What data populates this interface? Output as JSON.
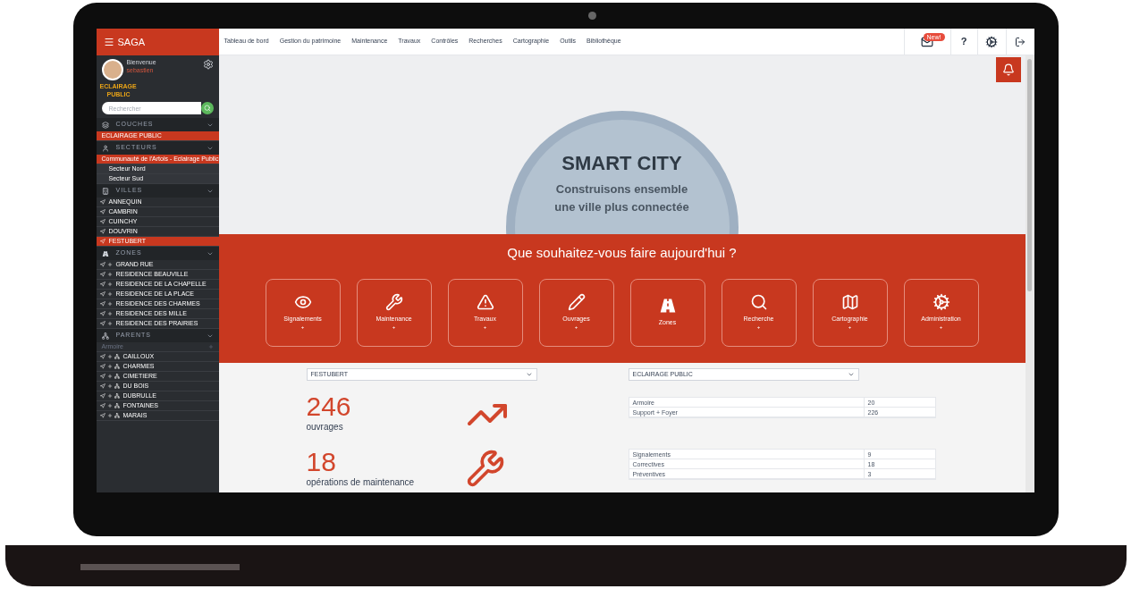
{
  "sidebar": {
    "brand": "SAGA",
    "greeting": "Bienvenue",
    "user_name": "sebastien",
    "logo_lines": [
      "ECLAIRAGE",
      "PUBLIC"
    ],
    "search": {
      "placeholder": "Rechercher"
    },
    "sections": [
      {
        "kind": "couches",
        "title": "COUCHES",
        "items": [
          {
            "label": "ECLAIRAGE PUBLIC",
            "selected": true
          }
        ]
      },
      {
        "kind": "secteurs",
        "title": "SECTEURS",
        "items": [
          {
            "label": "Communauté de l'Artois - Eclairage Public",
            "selected": true
          },
          {
            "label": "Secteur Nord",
            "selected": false
          },
          {
            "label": "Secteur Sud",
            "selected": false
          }
        ]
      },
      {
        "kind": "villes",
        "title": "VILLES",
        "items": [
          {
            "label": "ANNEQUIN",
            "selected": false
          },
          {
            "label": "CAMBRIN",
            "selected": false
          },
          {
            "label": "CUINCHY",
            "selected": false
          },
          {
            "label": "DOUVRIN",
            "selected": false
          },
          {
            "label": "FESTUBERT",
            "selected": true
          }
        ]
      },
      {
        "kind": "zones",
        "title": "ZONES",
        "items": [
          {
            "label": "GRAND RUE",
            "selected": false
          },
          {
            "label": "RESIDENCE BEAUVILLE",
            "selected": false
          },
          {
            "label": "RESIDENCE DE LA CHAPELLE",
            "selected": false
          },
          {
            "label": "RESIDENCE DE LA PLACE",
            "selected": false
          },
          {
            "label": "RESIDENCE DES CHARMES",
            "selected": false
          },
          {
            "label": "RESIDENCE DES MILLE",
            "selected": false
          },
          {
            "label": "RESIDENCE DES PRAIRIES",
            "selected": false
          }
        ]
      },
      {
        "kind": "parents",
        "title": "PARENTS",
        "subheader": "Armoire",
        "items": [
          {
            "label": "CAILLOUX",
            "selected": false
          },
          {
            "label": "CHARMES",
            "selected": false
          },
          {
            "label": "CIMETIERE",
            "selected": false
          },
          {
            "label": "DU BOIS",
            "selected": false
          },
          {
            "label": "DUBRULLE",
            "selected": false
          },
          {
            "label": "FONTAINES",
            "selected": false
          },
          {
            "label": "MARAIS",
            "selected": false
          }
        ]
      }
    ]
  },
  "top_nav": [
    "Tableau de bord",
    "Gestion du patrimoine",
    "Maintenance",
    "Travaux",
    "Contrôles",
    "Recherches",
    "Cartographie",
    "Outils",
    "Bibliothèque"
  ],
  "top_actions": {
    "mail_badge": "New!",
    "help": "?"
  },
  "hero": {
    "title": "SMART CITY",
    "subtitle_lines": [
      "Construisons ensemble",
      "une ville plus connectée"
    ]
  },
  "actions": {
    "question": "Que souhaitez-vous faire aujourd'hui ?",
    "tiles": [
      {
        "kind": "eye",
        "label": "Signalements",
        "plus": "+"
      },
      {
        "kind": "wrench",
        "label": "Maintenance",
        "plus": "+"
      },
      {
        "kind": "warning",
        "label": "Travaux",
        "plus": "+"
      },
      {
        "kind": "pencil",
        "label": "Ouvrages",
        "plus": "+"
      },
      {
        "kind": "road",
        "label": "Zones"
      },
      {
        "kind": "search",
        "label": "Recherche",
        "plus": "+"
      },
      {
        "kind": "map",
        "label": "Cartographie",
        "plus": "+"
      },
      {
        "kind": "cogs",
        "label": "Administration",
        "plus": "+"
      }
    ]
  },
  "dashboard": {
    "town_select": "FESTUBERT",
    "layer_select": "ECLAIRAGE PUBLIC",
    "blocks": [
      {
        "kind": "chart",
        "value": "246",
        "label": "ouvrages",
        "rows": [
          [
            "Armoire",
            "20"
          ],
          [
            "Support + Foyer",
            "226"
          ]
        ]
      },
      {
        "kind": "wrench",
        "value": "18",
        "label": "opérations de maintenance",
        "rows": [
          [
            "Signalements",
            "9"
          ],
          [
            "Correctives",
            "18"
          ],
          [
            "Préventives",
            "3"
          ]
        ]
      }
    ]
  }
}
